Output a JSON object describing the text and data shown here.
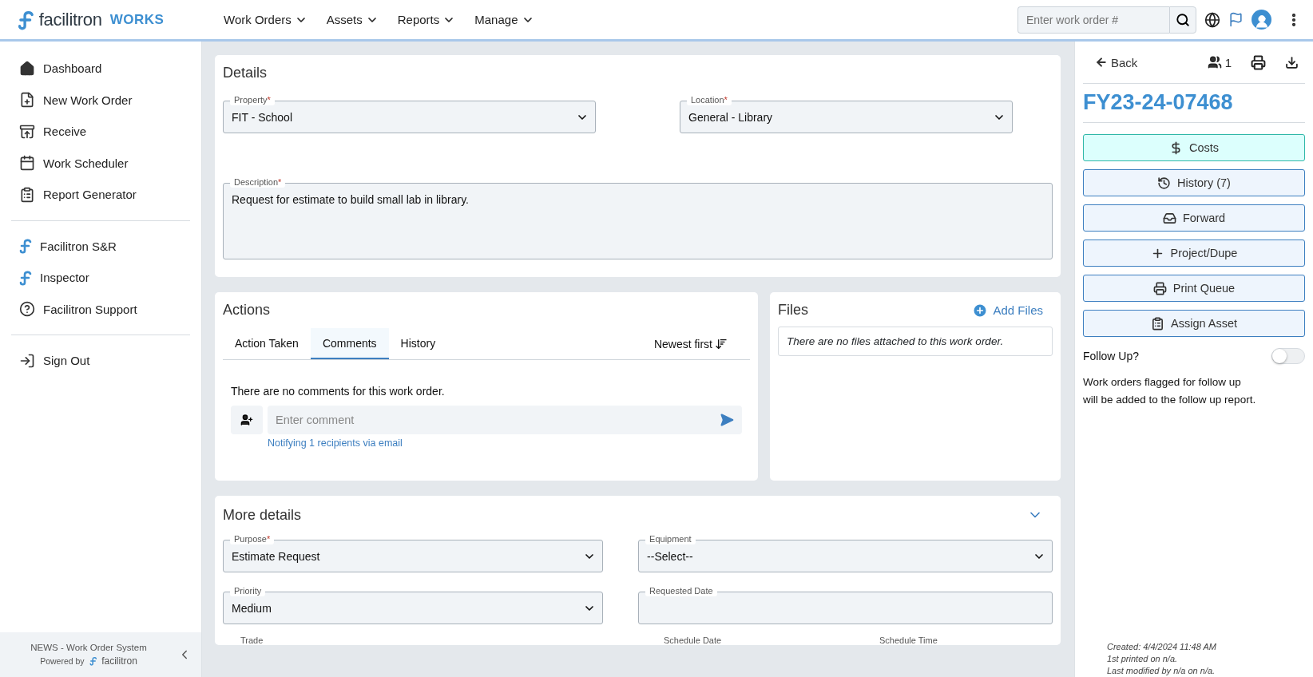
{
  "header": {
    "brand": "facilitron",
    "product": "WORKS",
    "nav": [
      {
        "label": "Work Orders"
      },
      {
        "label": "Assets"
      },
      {
        "label": "Reports"
      },
      {
        "label": "Manage"
      }
    ],
    "search": {
      "placeholder": "Enter work order #"
    }
  },
  "sidebar": {
    "groups": [
      [
        {
          "label": "Dashboard"
        },
        {
          "label": "New Work Order"
        },
        {
          "label": "Receive"
        },
        {
          "label": "Work Scheduler"
        },
        {
          "label": "Report Generator"
        }
      ],
      [
        {
          "label": "Facilitron S&R"
        },
        {
          "label": "Inspector"
        },
        {
          "label": "Facilitron Support"
        }
      ],
      [
        {
          "label": "Sign Out"
        }
      ]
    ],
    "footer": {
      "system": "NEWS - Work Order System",
      "powered": "Powered by",
      "brand": "facilitron"
    }
  },
  "details": {
    "title": "Details",
    "fields": [
      {
        "label": "Property",
        "required": "*",
        "value": "FIT - School",
        "kind": "select"
      },
      {
        "label": "Location",
        "required": "*",
        "value": "General - Library",
        "kind": "select"
      },
      {
        "label": "Description",
        "required": "*",
        "value": "Request for estimate to build small lab in library.",
        "kind": "textarea"
      }
    ]
  },
  "actions": {
    "title": "Actions",
    "tabs": [
      {
        "label": "Action Taken",
        "selected": false
      },
      {
        "label": "Comments",
        "selected": true
      },
      {
        "label": "History",
        "selected": false
      }
    ],
    "sort": "Newest first",
    "empty": "There are no comments for this work order.",
    "comment": {
      "placeholder": "Enter comment"
    },
    "notify": "Notifying 1 recipients via email"
  },
  "files": {
    "title": "Files",
    "add": "Add Files",
    "empty": "There are no files attached to this work order."
  },
  "more_details": {
    "title": "More details",
    "fields": [
      {
        "label": "Purpose",
        "required": "*",
        "value": "Estimate Request",
        "kind": "select"
      },
      {
        "label": "Equipment",
        "value": "--Select--",
        "kind": "select"
      },
      {
        "label": "Priority",
        "value": "Medium",
        "kind": "select"
      },
      {
        "label": "Requested Date",
        "kind": "date"
      }
    ],
    "cut_labels": [
      "Trade",
      "Schedule Date",
      "Schedule Time"
    ]
  },
  "panel": {
    "back": "Back",
    "watchers": "1",
    "number": "FY23-24-07468",
    "buttons": [
      {
        "label": "Costs",
        "highlighted": true
      },
      {
        "label": "History (7)",
        "highlighted": false
      },
      {
        "label": "Forward",
        "highlighted": false
      },
      {
        "label": "Project/Dupe",
        "highlighted": false
      },
      {
        "label": "Print Queue",
        "highlighted": false
      },
      {
        "label": "Assign Asset",
        "highlighted": false
      }
    ],
    "follow_up": {
      "label": "Follow Up?",
      "on": false
    },
    "note": "Work orders flagged for follow up will be added to the follow up report.",
    "meta": [
      "Created: 4/4/2024 11:48 AM",
      "1st printed on n/a.",
      "Last modified by n/a on n/a."
    ]
  }
}
